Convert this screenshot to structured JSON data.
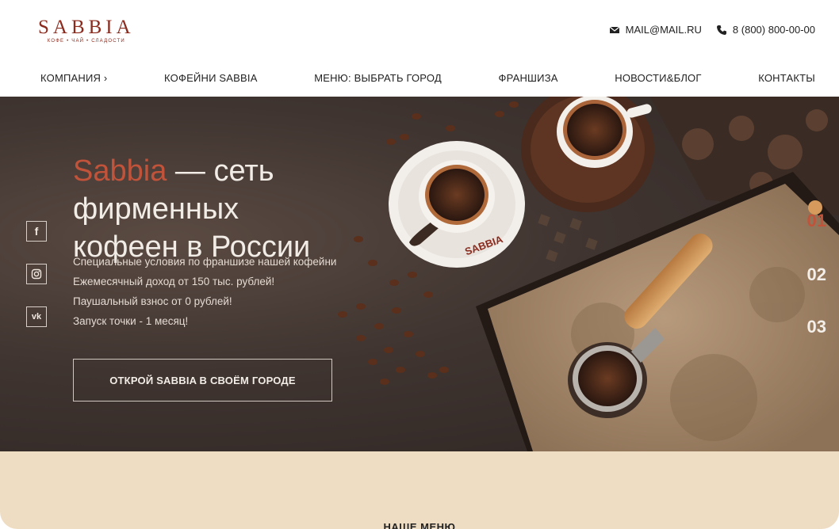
{
  "logo": {
    "name": "SABBIA",
    "tagline": "КОФЕ • ЧАЙ • СЛАДОСТИ"
  },
  "contacts": {
    "email": "MAIL@MAIL.RU",
    "phone": "8 (800) 800-00-00"
  },
  "nav": {
    "items": [
      {
        "label": "КОМПАНИЯ ›"
      },
      {
        "label": "КОФЕЙНИ SABBIA"
      },
      {
        "label": "МЕНЮ: ВЫБРАТЬ ГОРОД"
      },
      {
        "label": "ФРАНШИЗА"
      },
      {
        "label": "НОВОСТИ&БЛОГ"
      },
      {
        "label": "КОНТАКТЫ"
      }
    ]
  },
  "hero": {
    "title_accent": "Sabbia",
    "title_rest_line1": " — сеть фирменных",
    "title_line2": "кофеен в России",
    "bullets": [
      "Специальные условия по франшизе нашей кофейни",
      "Ежемесячный доход от 150 тыс. рублей!",
      "Паушальный взнос от 0 рублей!",
      "Запуск точки - 1 месяц!"
    ],
    "cta": "ОТКРОЙ SABBIA В СВОЁМ ГОРОДЕ",
    "cup_brand": "SABBIA",
    "slides": [
      "01",
      "02",
      "03"
    ],
    "active_slide": "01"
  },
  "social": {
    "facebook": "f",
    "instagram": "instagram-icon",
    "vk": "vk"
  },
  "section": {
    "title": "НАШЕ МЕНЮ"
  },
  "colors": {
    "accent": "#c0533a",
    "brand": "#8b2b1e",
    "band": "#eedcc3"
  }
}
